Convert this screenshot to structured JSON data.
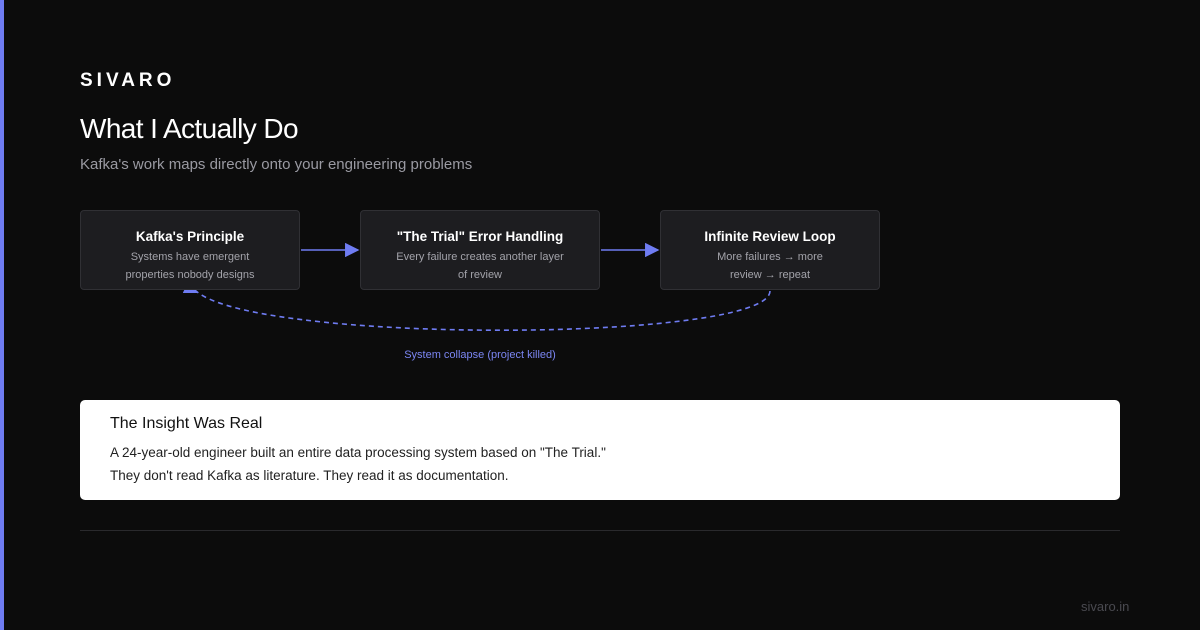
{
  "brand": "SIVARO",
  "title": "What I Actually Do",
  "subtitle": "Kafka's work maps directly onto your engineering problems",
  "diagram": {
    "nodes": [
      {
        "title": "Kafka's Principle",
        "desc": "Systems have emergent properties nobody designs"
      },
      {
        "title": "\"The Trial\" Error Handling",
        "desc": "Every failure creates another layer of review"
      },
      {
        "title": "Infinite Review Loop",
        "desc": "More failures → more review → repeat"
      }
    ],
    "loop_label": "System collapse (project killed)",
    "colors": {
      "arrow": "#6f7cf2",
      "node_bg": "#1d1d20"
    }
  },
  "insight": {
    "title": "The Insight Was Real",
    "lines": [
      "A 24-year-old engineer built an entire data processing system based on \"The Trial.\"",
      "They don't read Kafka as literature. They read it as documentation."
    ]
  },
  "footer": {
    "url": "sivaro.in"
  },
  "colors": {
    "background": "#0c0c0c",
    "accent": "#6f7cf2"
  }
}
